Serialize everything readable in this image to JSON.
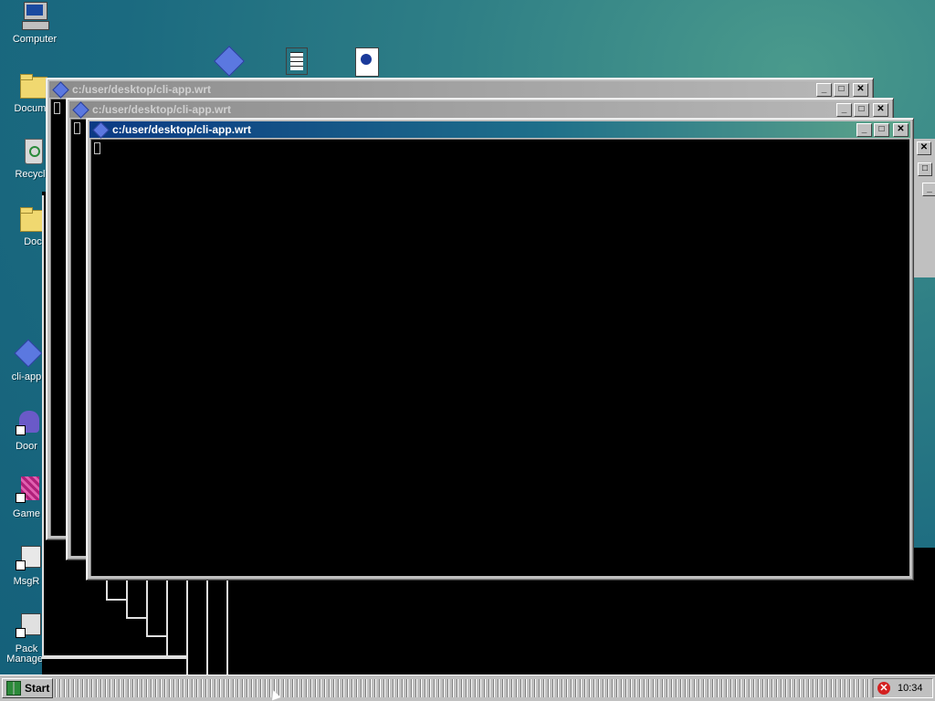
{
  "desktop": {
    "icons": [
      {
        "label": "Computer",
        "icon": "computer-icon"
      },
      {
        "label": "Docume",
        "icon": "folder-icon"
      },
      {
        "label": "Recycle",
        "icon": "recycle-bin-icon"
      },
      {
        "label": "Doc",
        "icon": "folder-icon"
      },
      {
        "label": "cli-app",
        "icon": "app-diamond-icon"
      },
      {
        "label": "Door",
        "icon": "shortcut-icon"
      },
      {
        "label": "Game",
        "icon": "shortcut-icon"
      },
      {
        "label": "MsgR",
        "icon": "shortcut-icon"
      },
      {
        "label": "Pack",
        "icon": "shortcut-icon"
      },
      {
        "label": "Manager",
        "icon": "shortcut-icon"
      }
    ]
  },
  "windows": [
    {
      "title": "c:/user/desktop/cli-app.wrt",
      "state": "inactive"
    },
    {
      "title": "c:/user/desktop/cli-app.wrt",
      "state": "inactive"
    },
    {
      "title": "c:/user/desktop/cli-app.wrt",
      "state": "active"
    }
  ],
  "window_buttons": {
    "minimize": "_",
    "maximize": "□",
    "close": "✕"
  },
  "taskbar": {
    "start_label": "Start",
    "clock": "10:34",
    "tray_alert": "✕"
  },
  "colors": {
    "desktop": "#1b6a80",
    "active_title_start": "#0b3a84",
    "active_title_end": "#5ea58a",
    "terminal_bg": "#000000"
  }
}
